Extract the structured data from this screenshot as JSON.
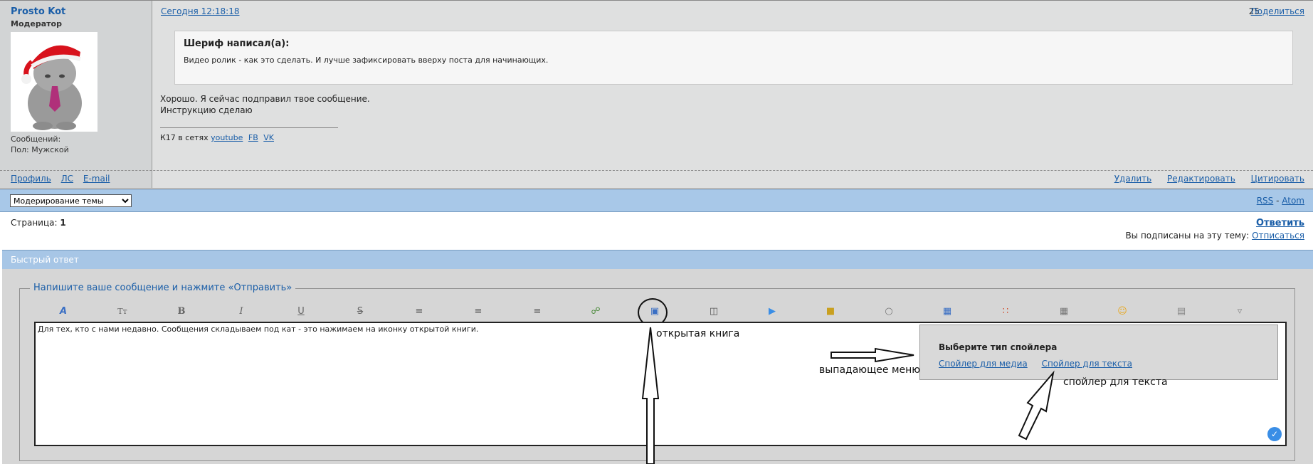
{
  "post": {
    "author": "Prosto Kot",
    "role": "Модератор",
    "messages_label": "Сообщений:",
    "gender": "Пол: Мужской",
    "left_links": [
      "Профиль",
      "ЛС",
      "E-mail"
    ],
    "date": "Сегодня 12:18:18",
    "number": "25",
    "share": "Поделиться",
    "quote_author": "Шериф написал(а):",
    "quote_text": "Видео ролик - как это сделать. И лучше зафиксировать вверху поста для начинающих.",
    "body_lines": [
      "Хорошо. Я сейчас подправил твое сообщение.",
      "Инструкцию сделаю"
    ],
    "signature_prefix": "К17 в сетях",
    "signature_links": [
      "youtube",
      "FB",
      "VK"
    ],
    "actions": [
      "Удалить",
      "Редактировать",
      "Цитировать"
    ]
  },
  "moderation": {
    "select_value": "Модерирование темы",
    "rss": "RSS",
    "sep": " - ",
    "atom": "Atom"
  },
  "pages": {
    "label": "Страница:",
    "current": "1"
  },
  "reply_link": "Ответить",
  "subscription": {
    "text": "Вы подписаны на эту тему:",
    "link": "Отписаться"
  },
  "quick_reply": {
    "header": "Быстрый ответ",
    "legend": "Напишите ваше сообщение и нажмите «Отправить»",
    "editor_text": "Для тех, кто с нами недавно. Сообщения складываем под кат - это нажимаем на иконку открытой книги."
  },
  "spoiler_menu": {
    "title": "Выберите тип спойлера",
    "options": [
      "Спойлер для медиа",
      "Спойлер для текста"
    ]
  },
  "annotations": {
    "open_book": "открытая книга",
    "dropdown": "выпадающее меню",
    "text_spoiler": "спойлер для текста"
  },
  "toolbar_icons": [
    "font-color-icon",
    "font-size-icon",
    "bold-icon",
    "italic-icon",
    "underline-icon",
    "strikethrough-icon",
    "align-left-icon",
    "align-center-icon",
    "align-right-icon",
    "link-icon",
    "spoiler-book-icon",
    "image-icon",
    "video-icon",
    "hide-lock-icon",
    "quote-icon",
    "code-icon",
    "color-icon",
    "table-icon",
    "smiley-icon",
    "keyboard-icon",
    "more-icon"
  ]
}
